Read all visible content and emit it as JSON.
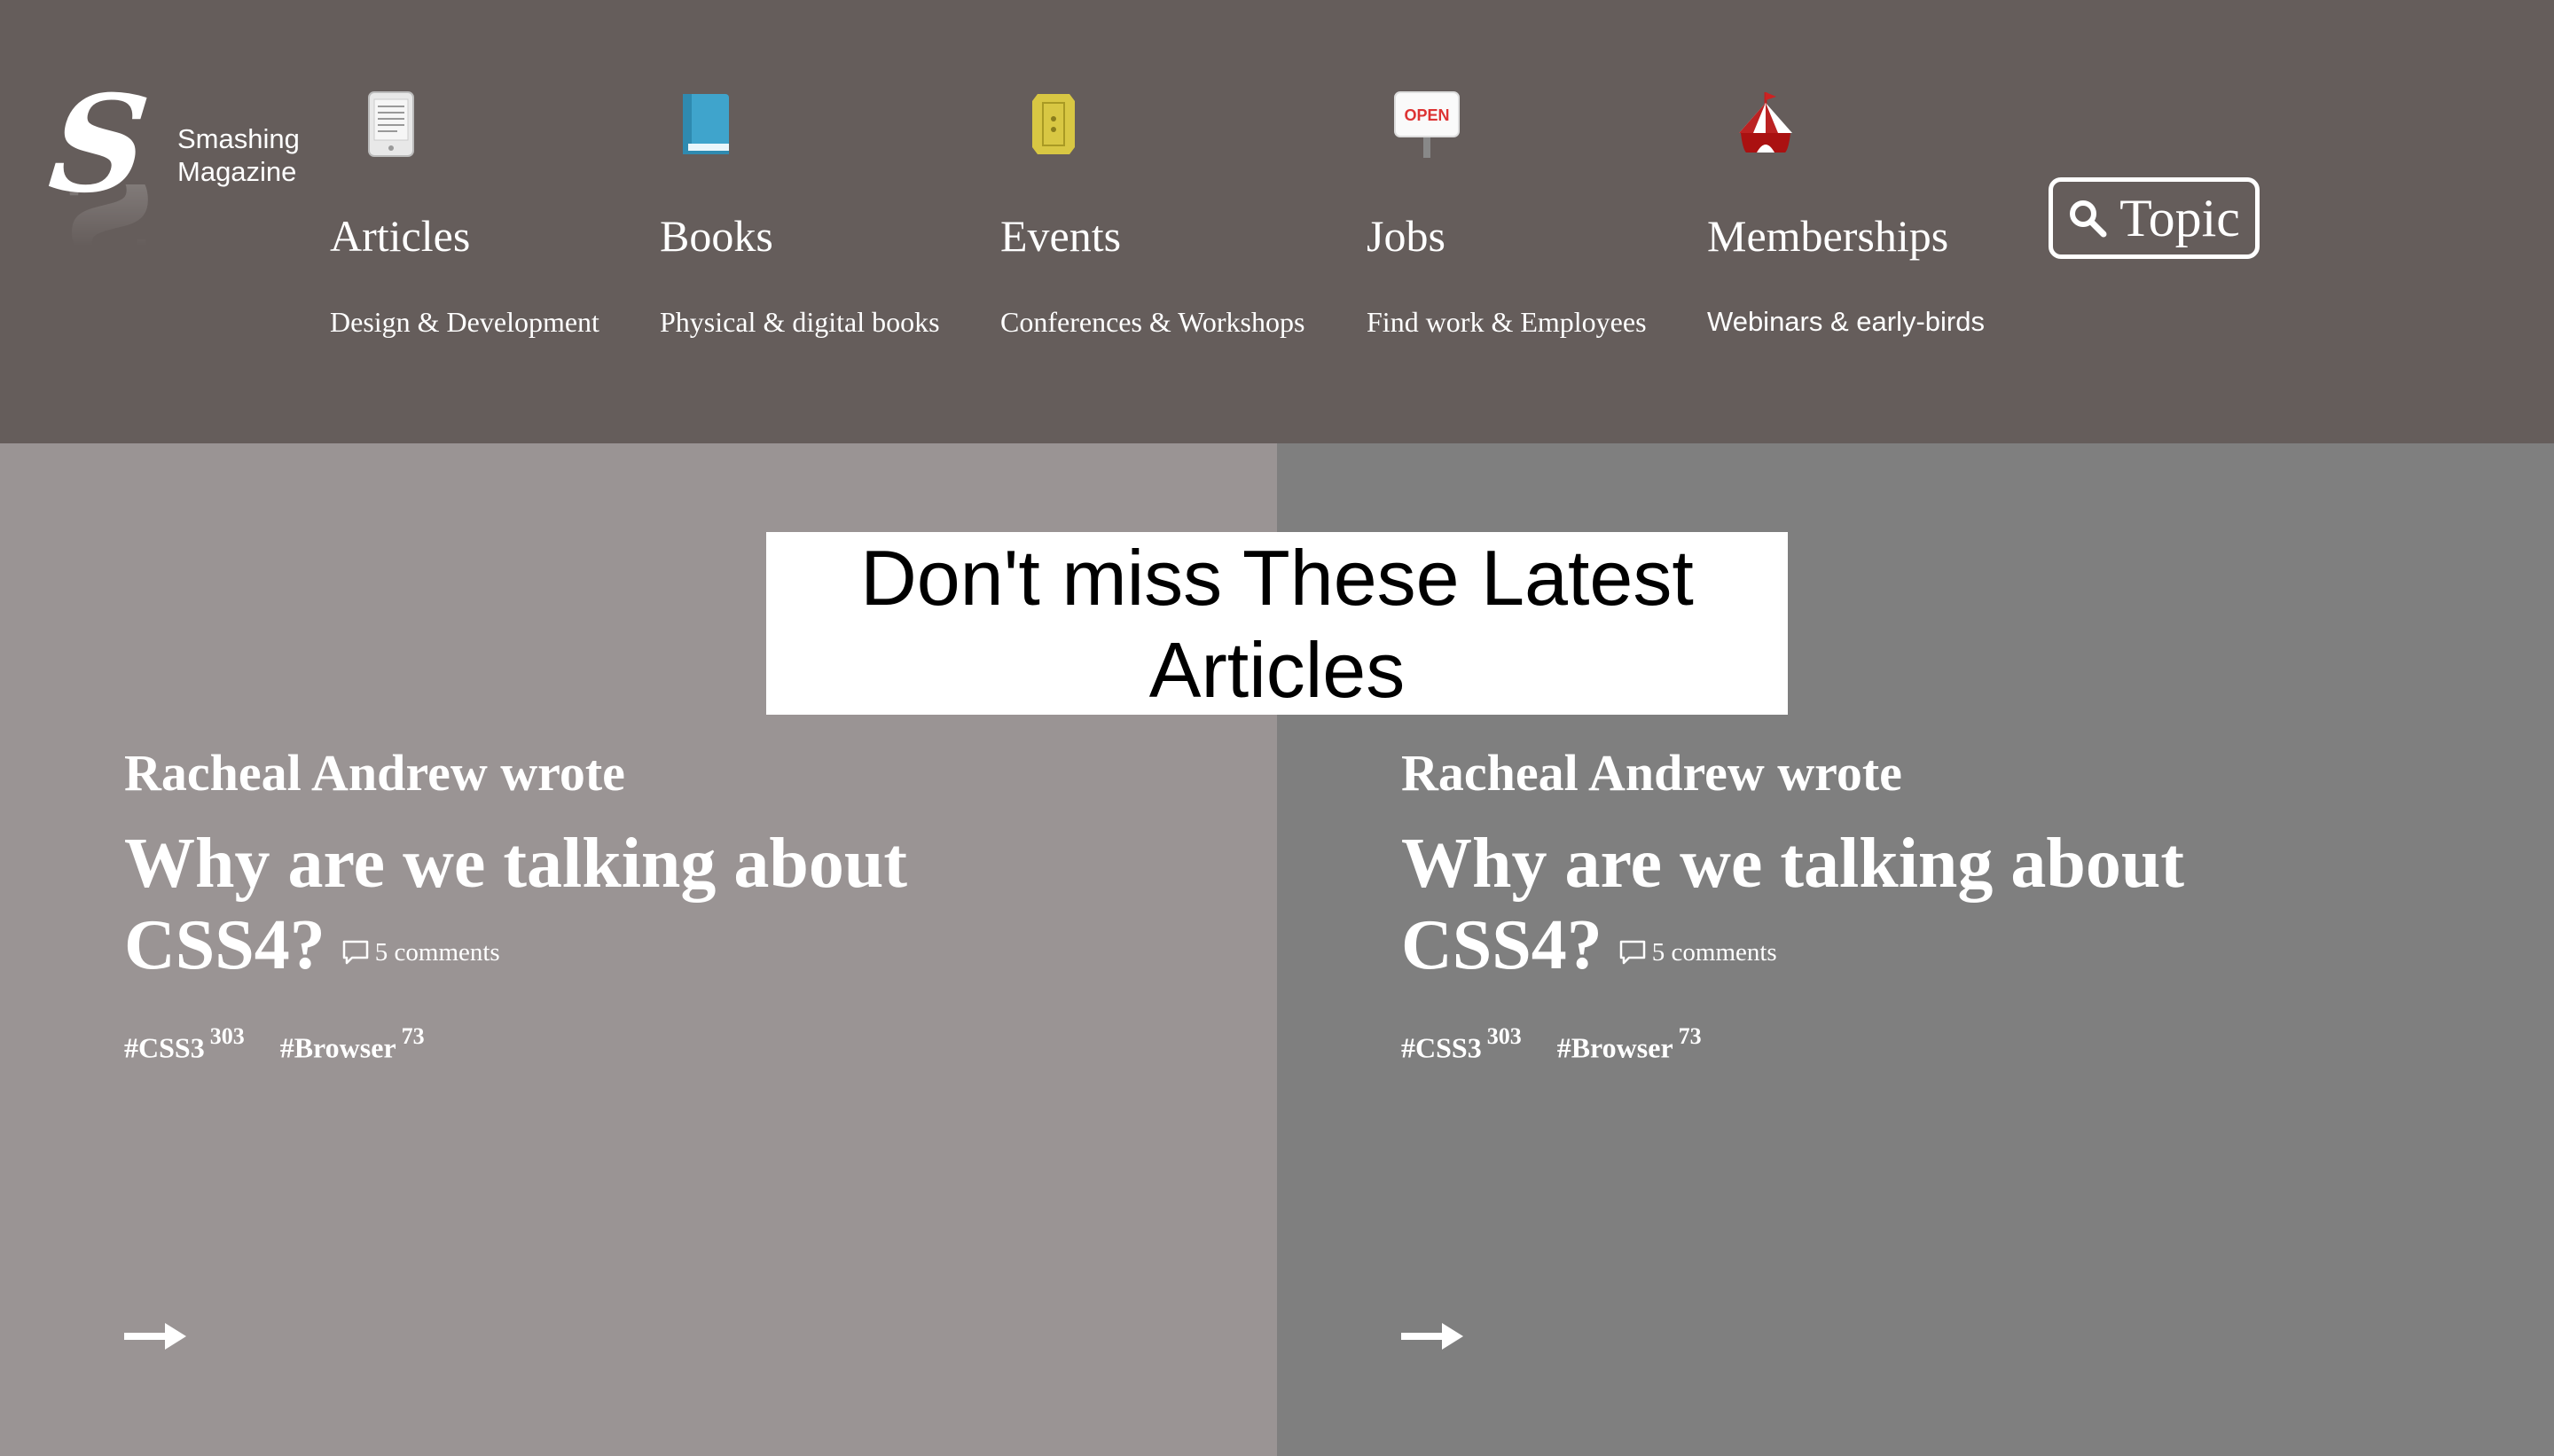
{
  "brand": {
    "line1": "Smashing",
    "line2": "Magazine",
    "mark": "S"
  },
  "nav": [
    {
      "title": "Articles",
      "subtitle": "Design & Development",
      "icon": "ereader-icon"
    },
    {
      "title": "Books",
      "subtitle": "Physical & digital books",
      "icon": "book-icon"
    },
    {
      "title": "Events",
      "subtitle": "Conferences & Workshops",
      "icon": "ticket-icon"
    },
    {
      "title": "Jobs",
      "subtitle": "Find work & Employees",
      "icon": "open-sign-icon",
      "sign_text": "OPEN"
    },
    {
      "title": "Memberships",
      "subtitle": "Webinars & early-birds",
      "icon": "circus-tent-icon"
    }
  ],
  "topic_button": {
    "label": "Topic",
    "icon": "search-icon"
  },
  "banner": {
    "line1": "Don't miss These Latest",
    "line2": "Articles"
  },
  "cards": [
    {
      "author": "Racheal Andrew wrote",
      "title": "Why are we talking about CSS4?",
      "comments": "5 comments",
      "tags": [
        {
          "name": "#CSS3",
          "count": "303"
        },
        {
          "name": "#Browser",
          "count": "73"
        }
      ]
    },
    {
      "author": "Racheal Andrew wrote",
      "title": "Why are we talking about CSS4?",
      "comments": "5 comments",
      "tags": [
        {
          "name": "#CSS3",
          "count": "303"
        },
        {
          "name": "#Browser",
          "count": "73"
        }
      ]
    }
  ],
  "colors": {
    "header": "#655d5b",
    "panel_left": "#9a9494",
    "panel_right": "#7f7f7f",
    "banner": "#ffffff"
  }
}
